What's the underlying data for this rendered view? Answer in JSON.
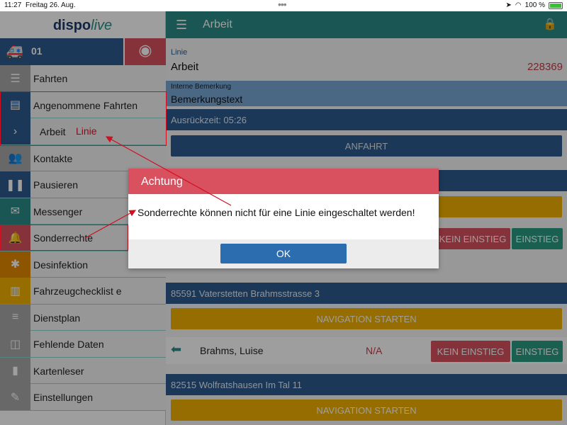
{
  "status_bar": {
    "time": "11:27",
    "date": "Freitag 26. Aug.",
    "battery": "100 %"
  },
  "sidebar": {
    "logo_a": "dispo",
    "logo_b": "live",
    "vehicle_number": "01",
    "items": [
      {
        "label": "Fahrten",
        "icon": "list-icon",
        "color": "#a9a9a9"
      },
      {
        "label": "Angenommene Fahrten",
        "icon": "id-card-icon",
        "color": "#2c5b8e"
      },
      {
        "label": "Arbeit",
        "icon": "chevron-right-icon",
        "color": "#2c5b8e",
        "sub": true,
        "annotation": "Linie"
      },
      {
        "label": "Kontakte",
        "icon": "users-icon",
        "color": "#a9a9a9"
      },
      {
        "label": "Pausieren",
        "icon": "pause-icon",
        "color": "#2c5b8e"
      },
      {
        "label": "Messenger",
        "icon": "envelope-icon",
        "color": "#2a8c87"
      },
      {
        "label": "Sonderrechte",
        "icon": "bell-icon",
        "color": "#d9515f"
      },
      {
        "label": "Desinfektion",
        "icon": "bug-icon",
        "color": "#e68a00"
      },
      {
        "label": "Fahrzeugchecklist e",
        "icon": "book-icon",
        "color": "#f0b000"
      },
      {
        "label": "Dienstplan",
        "icon": "list-alt-icon",
        "color": "#a9a9a9"
      },
      {
        "label": "Fehlende Daten",
        "icon": "database-icon",
        "color": "#a9a9a9"
      },
      {
        "label": "Kartenleser",
        "icon": "signal-icon",
        "color": "#a9a9a9"
      },
      {
        "label": "Einstellungen",
        "icon": "wrench-icon",
        "color": "#a9a9a9"
      }
    ]
  },
  "main": {
    "title": "Arbeit",
    "linie_label": "Linie",
    "linie_value": "Arbeit",
    "linie_number": "228369",
    "bemerkung_label": "Interne Bemerkung",
    "bemerkung_value": "Bemerkungstext",
    "ausrueck": "Ausrückzeit: 05:26",
    "anfahrt": "ANFAHRT",
    "kein_einstieg": "KEIN EINSTIEG",
    "einstieg": "EINSTIEG",
    "stop1": "85591 Vaterstetten Brahmsstrasse 3",
    "navigation": "NAVIGATION STARTEN",
    "person_name": "Brahms, Luise",
    "person_status": "N/A",
    "stop2": "82515 Wolfratshausen Im Tal 11"
  },
  "dialog": {
    "title": "Achtung",
    "message": "Sonderrechte können nicht für eine Linie eingeschaltet werden!",
    "ok": "OK"
  },
  "colors": {
    "teal": "#2a8c87",
    "blue": "#2c5b8e",
    "red": "#d9515f",
    "yellow": "#f0b000"
  }
}
